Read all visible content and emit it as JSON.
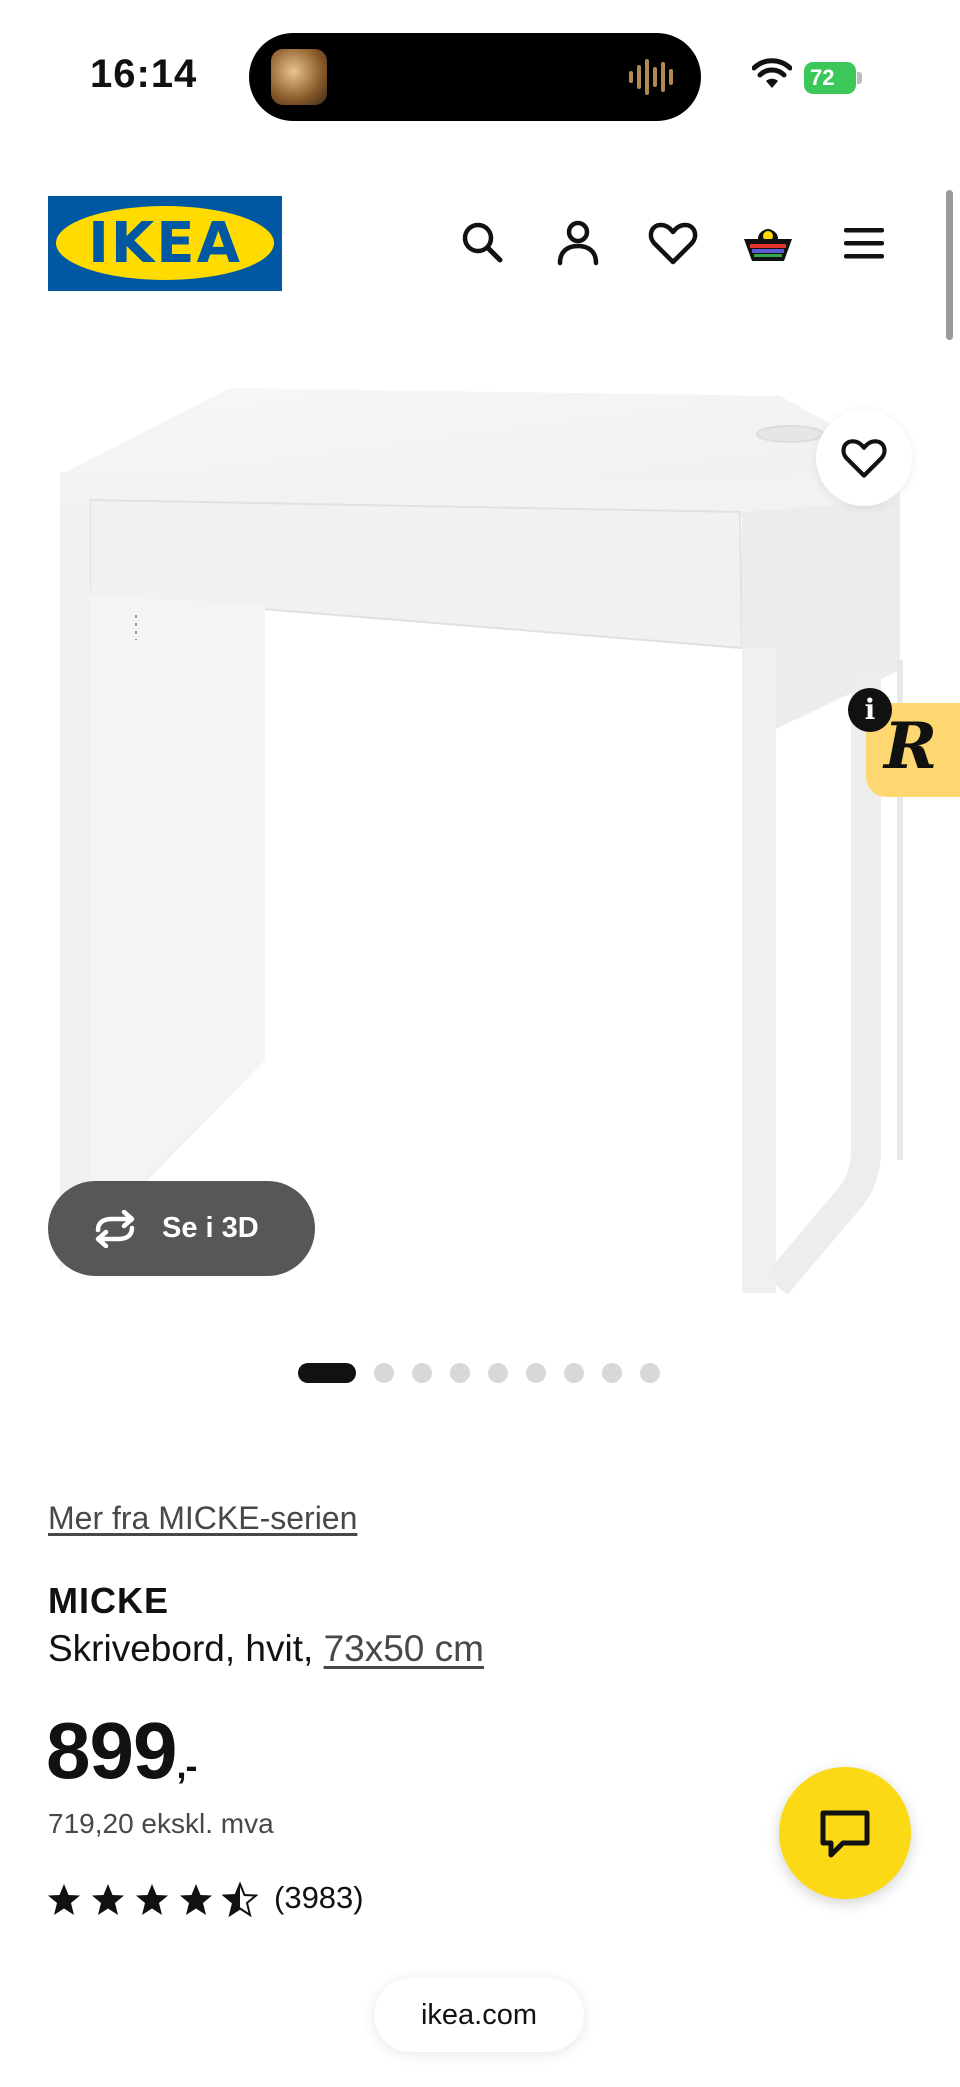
{
  "status_bar": {
    "time": "16:14",
    "battery_level": "72",
    "battery_color": "#3cc75a",
    "icons": [
      "wifi-icon",
      "battery-icon",
      "audio-waveform-icon"
    ]
  },
  "header": {
    "logo_text": "IKEA",
    "brand_colors": {
      "blue": "#0058a3",
      "yellow": "#ffdb00"
    },
    "icons": [
      "search-icon",
      "account-icon",
      "heart-icon",
      "basket-icon",
      "menu-icon"
    ]
  },
  "gallery": {
    "view_3d_label": "Se i 3D",
    "total_images": 9,
    "active_index": 0,
    "badge_icon": "info-icon",
    "extension_letter": "R"
  },
  "product": {
    "series_link": "Mer fra MICKE-serien",
    "name": "MICKE",
    "description_prefix": "Skrivebord, hvit, ",
    "size_link": "73x50 cm",
    "price": "899",
    "price_suffix": ",-",
    "price_ex_vat": "719,20 ekskl. mva",
    "rating": 4.5,
    "rating_max": 5,
    "review_count": "(3983)"
  },
  "chat": {
    "icon": "chat-icon",
    "color": "#fbd914"
  },
  "browser": {
    "url": "ikea.com"
  }
}
